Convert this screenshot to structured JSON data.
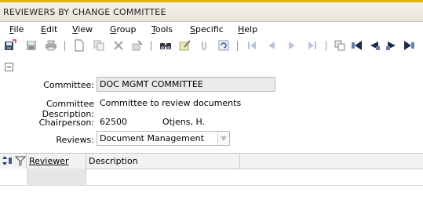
{
  "window": {
    "title": "REVIEWERS BY CHANGE COMMITTEE"
  },
  "menu": [
    {
      "label": "File",
      "mnemonic": "F",
      "rest": "ile"
    },
    {
      "label": "Edit",
      "mnemonic": "E",
      "rest": "dit"
    },
    {
      "label": "View",
      "mnemonic": "V",
      "rest": "iew"
    },
    {
      "label": "Group",
      "mnemonic": "G",
      "rest": "roup"
    },
    {
      "label": "Tools",
      "mnemonic": "T",
      "rest": "ools"
    },
    {
      "label": "Specific",
      "mnemonic": "S",
      "rest": "pecific"
    },
    {
      "label": "Help",
      "mnemonic": "H",
      "rest": "elp"
    }
  ],
  "toolbar": {
    "icons": [
      "save-exit-icon",
      "save-icon",
      "print-icon",
      "new-icon",
      "copy-icon",
      "delete-icon",
      "clear-icon",
      "find-icon",
      "edit-icon",
      "attach-icon",
      "refresh-icon",
      "first-record-icon",
      "previous-record-icon",
      "next-record-icon",
      "last-record-icon",
      "duplicate-icon",
      "nav-a-icon",
      "nav-b-icon",
      "nav-c-icon",
      "nav-d-icon"
    ]
  },
  "form": {
    "committee_label": "Committee:",
    "committee_value": "DOC MGMT COMMITTEE",
    "description_label": "Committee Description:",
    "description_value": "Committee to review documents",
    "chairperson_label": "Chairperson:",
    "chairperson_id": "62500",
    "chairperson_name": "Otjens, H.",
    "reviews_label": "Reviews:",
    "reviews_value": "Document Management"
  },
  "grid": {
    "columns": [
      "Reviewer",
      "Description"
    ],
    "rows": [
      [
        "",
        ""
      ]
    ]
  },
  "colors": {
    "accent": "#e8b400",
    "field_bg": "#ebebeb",
    "header_bg": "#f2f2f2"
  }
}
